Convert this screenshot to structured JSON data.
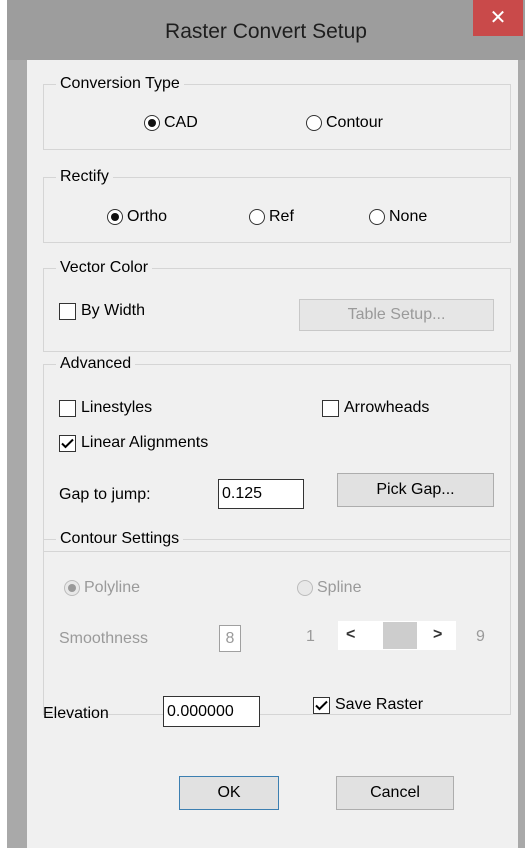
{
  "window": {
    "title": "Raster Convert Setup",
    "close_label": "✕"
  },
  "conversion_type": {
    "label": "Conversion Type",
    "options": [
      "CAD",
      "Contour"
    ],
    "selected": "CAD"
  },
  "rectify": {
    "label": "Rectify",
    "options": [
      "Ortho",
      "Ref",
      "None"
    ],
    "selected": "Ortho"
  },
  "vector_color": {
    "label": "Vector Color",
    "by_width_label": "By Width",
    "by_width_checked": false,
    "table_setup_label": "Table Setup..."
  },
  "advanced": {
    "label": "Advanced",
    "linestyles_label": "Linestyles",
    "arrowheads_label": "Arrowheads",
    "linear_alignments_label": "Linear Alignments",
    "gap_label": "Gap to jump:",
    "gap_value": "0.125",
    "pick_gap_label": "Pick Gap..."
  },
  "contour_settings": {
    "label": "Contour Settings",
    "polyline_label": "Polyline",
    "spline_label": "Spline",
    "smoothness_label": "Smoothness",
    "smoothness_value": "8",
    "slider_min": "1",
    "slider_max": "9",
    "slider_left_arrow": "<",
    "slider_right_arrow": ">"
  },
  "elevation": {
    "label": "Elevation",
    "value": "0.000000"
  },
  "save_raster": {
    "label": "Save Raster",
    "checked": true
  },
  "buttons": {
    "ok": "OK",
    "cancel": "Cancel"
  }
}
